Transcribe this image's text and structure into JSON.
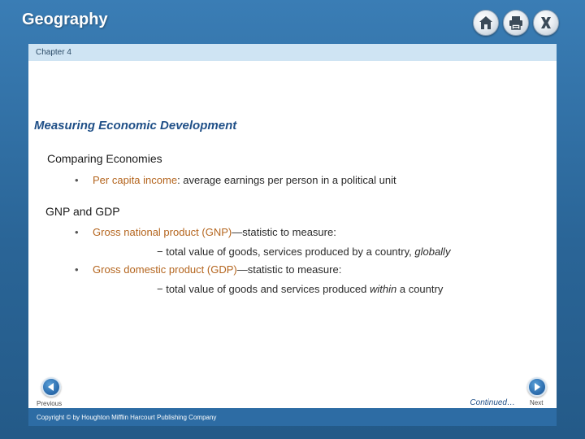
{
  "app": {
    "title": "Geography"
  },
  "toolbar": {
    "home_icon": "home-icon",
    "print_icon": "print-icon",
    "close_icon": "close-icon"
  },
  "chapter": "Chapter 4",
  "slide": {
    "title": "Measuring Economic Development",
    "sections": [
      {
        "heading": "Comparing Economies",
        "bullets": [
          {
            "dot": "•",
            "term": "Per capita income",
            "text": ": average earnings per person in a political unit"
          }
        ]
      },
      {
        "heading": "GNP and GDP",
        "bullets": [
          {
            "dot": "•",
            "term": "Gross national product (GNP)",
            "text": "—statistic to measure:",
            "sub": {
              "prefix": "− total value of goods, services produced by a country, ",
              "emph": "globally"
            }
          },
          {
            "dot": "•",
            "term": "Gross domestic product (GDP)",
            "text": "—statistic to measure:",
            "sub": {
              "prefix": "− total value of goods and services produced ",
              "emph": "within",
              "suffix": " a country"
            }
          }
        ]
      }
    ]
  },
  "nav": {
    "previous": "Previous",
    "next": "Next",
    "continued": "Continued…"
  },
  "footer": {
    "copyright": "Copyright © by Houghton Mifflin Harcourt Publishing Company"
  },
  "colors": {
    "background": "#2a6597",
    "title": "#1f4f87",
    "term": "#b4651e",
    "chapter_bar": "#cfe4f3",
    "footer_bar": "#2d6ca4"
  }
}
